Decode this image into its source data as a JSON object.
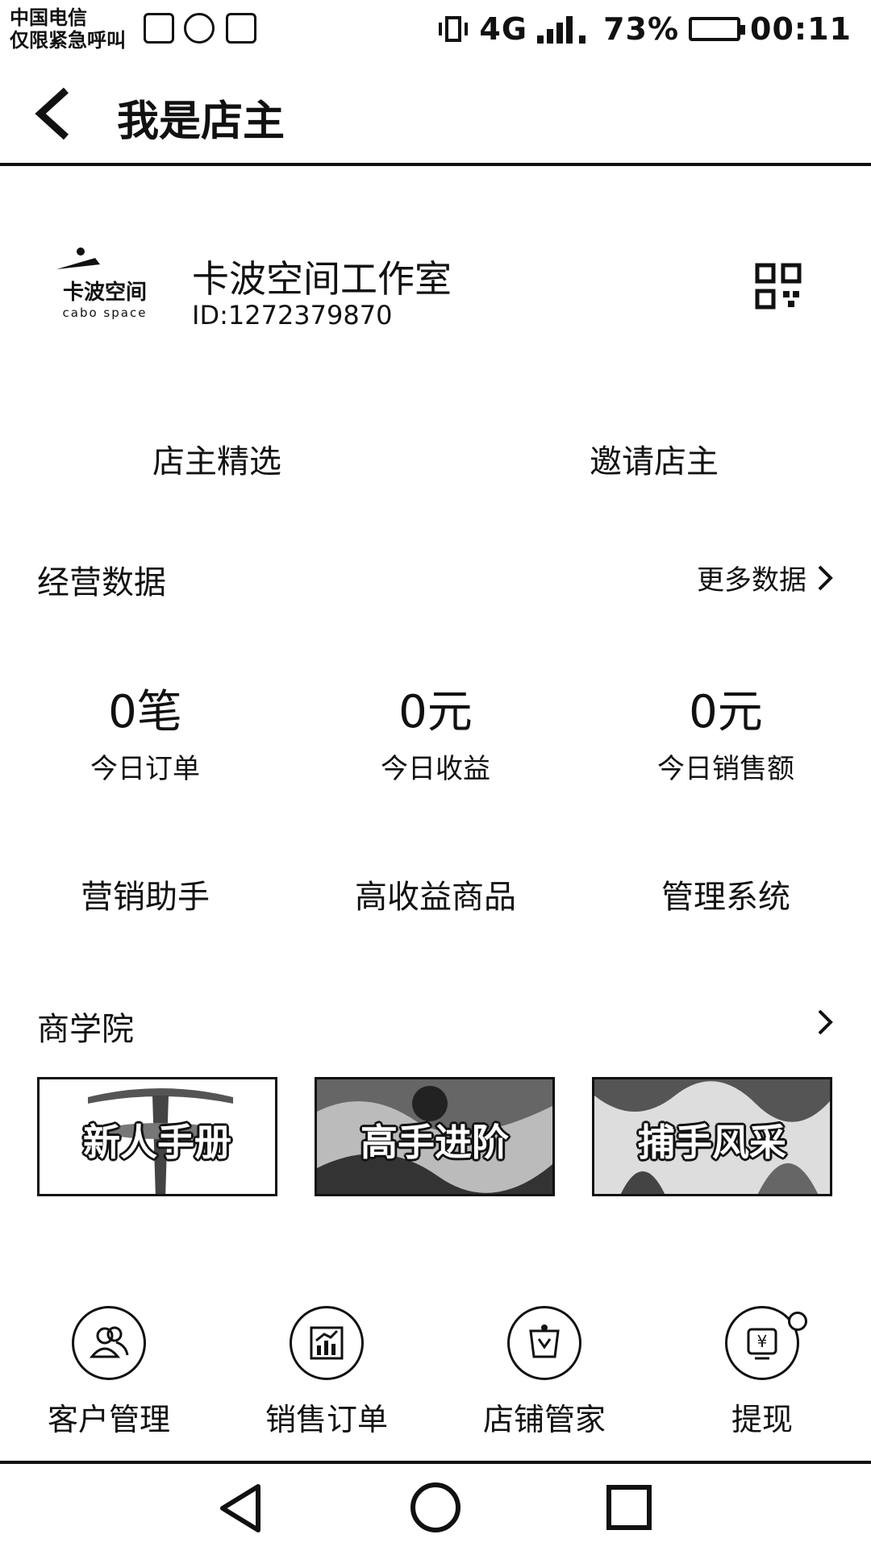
{
  "status_bar": {
    "carrier_line1": "中国电信",
    "carrier_line2": "仅限紧急呼叫",
    "network": "4G",
    "battery": "73%",
    "time": "00:11"
  },
  "header": {
    "title": "我是店主"
  },
  "shop": {
    "logo_text": "卡波空间",
    "logo_subtext": "cabo space",
    "name": "卡波空间工作室",
    "id": "ID:1272379870"
  },
  "tabs": [
    {
      "label": "店主精选"
    },
    {
      "label": "邀请店主"
    }
  ],
  "business_data": {
    "title": "经营数据",
    "more": "更多数据",
    "stats": [
      {
        "value": "0笔",
        "label": "今日订单"
      },
      {
        "value": "0元",
        "label": "今日收益"
      },
      {
        "value": "0元",
        "label": "今日销售额"
      }
    ]
  },
  "tools": [
    {
      "label": "营销助手"
    },
    {
      "label": "高收益商品"
    },
    {
      "label": "管理系统"
    }
  ],
  "academy": {
    "title": "商学院",
    "cards": [
      {
        "label": "新人手册"
      },
      {
        "label": "高手进阶"
      },
      {
        "label": "捕手风采"
      }
    ]
  },
  "bottom_actions": [
    {
      "label": "客户管理",
      "icon": "users-icon"
    },
    {
      "label": "销售订单",
      "icon": "chart-icon"
    },
    {
      "label": "店铺管家",
      "icon": "shop-icon"
    },
    {
      "label": "提现",
      "icon": "withdraw-icon"
    }
  ]
}
